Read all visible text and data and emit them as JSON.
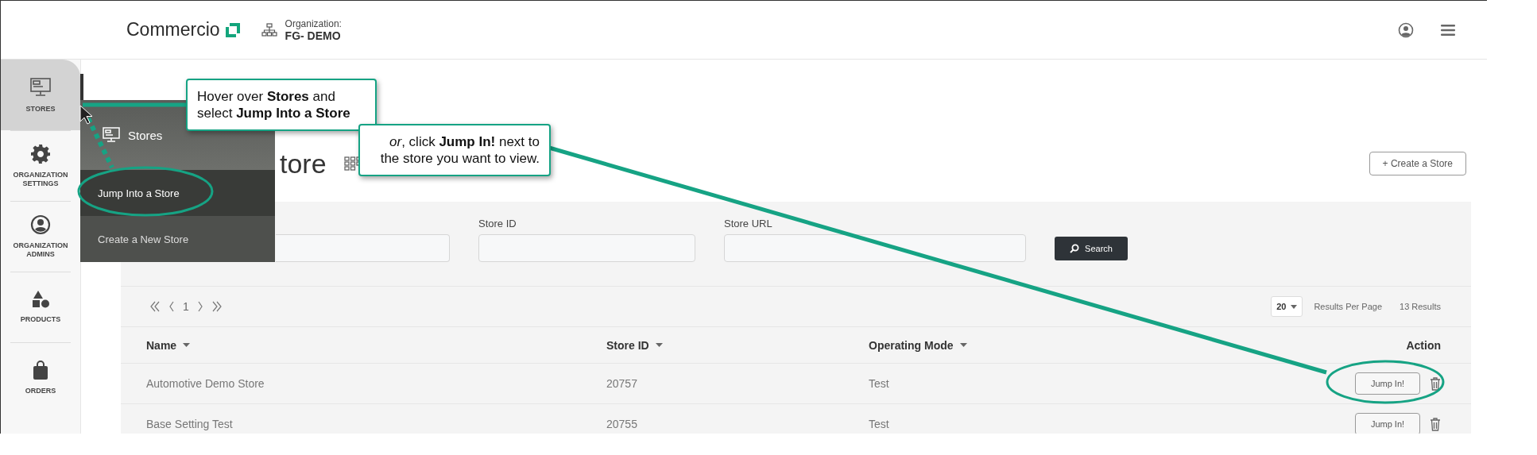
{
  "header": {
    "logo": "Commercio",
    "organization_label": "Organization:",
    "organization_name": "FG- DEMO"
  },
  "sidebar": {
    "items": [
      {
        "label": "STORES",
        "selected": true
      },
      {
        "label": "ORGANIZATION SETTINGS",
        "selected": false
      },
      {
        "label": "ORGANIZATION ADMINS",
        "selected": false
      },
      {
        "label": "PRODUCTS",
        "selected": false
      },
      {
        "label": "ORDERS",
        "selected": false
      }
    ]
  },
  "flyout": {
    "title": "Stores",
    "items": [
      {
        "label": "Jump Into a Store",
        "selected": true
      },
      {
        "label": "Create a New Store",
        "selected": false
      }
    ]
  },
  "page_title": "tore",
  "create_button": "+ Create a Store",
  "filters": [
    {
      "kind": "field"
    },
    {
      "kind": "field",
      "label": "Store ID"
    },
    {
      "kind": "field",
      "label": "Store URL"
    }
  ],
  "search_button": "Search",
  "pagination": {
    "page": "1",
    "page_size": "20",
    "page_size_label": "Results Per Page",
    "results": "13 Results"
  },
  "table": {
    "columns": [
      {
        "label": "Name",
        "sortable": true
      },
      {
        "label": "Store ID",
        "sortable": true
      },
      {
        "label": "Operating Mode",
        "sortable": true
      },
      {
        "label": "Action",
        "sortable": false
      }
    ],
    "rows": [
      {
        "name": "Automotive Demo Store",
        "store_id": "20757",
        "mode": "Test",
        "action": "Jump In!"
      },
      {
        "name": "Base Setting Test",
        "store_id": "20755",
        "mode": "Test",
        "action": "Jump In!"
      }
    ]
  },
  "callouts": [
    {
      "text": "Hover over **Stores** and select **Jump Into a Store**"
    },
    {
      "text": "*or*, click **Jump In!** next to the store you want to view."
    }
  ]
}
